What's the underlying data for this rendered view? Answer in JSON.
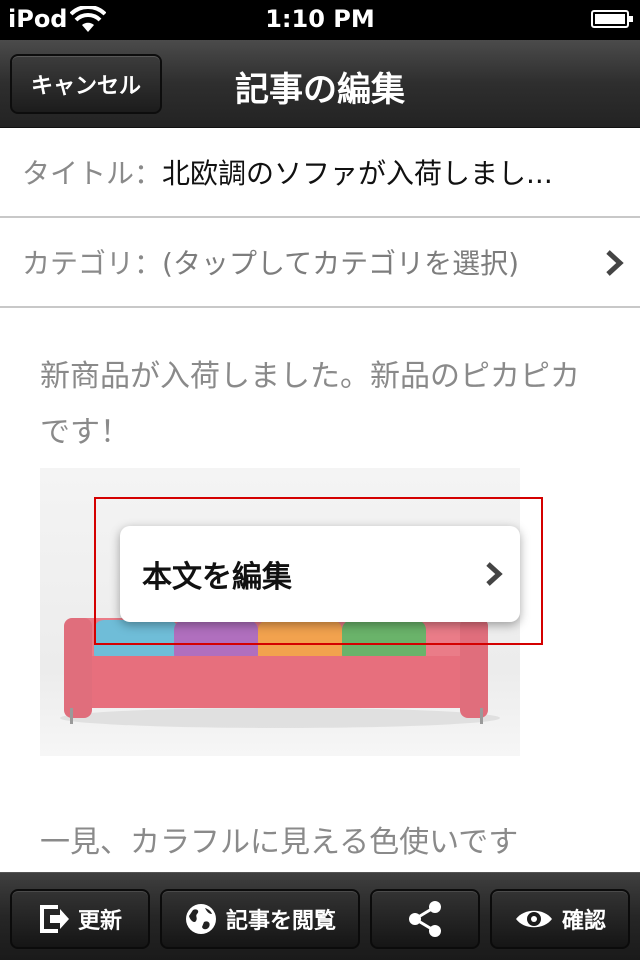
{
  "status_bar": {
    "carrier": "iPod",
    "time": "1:10 PM",
    "battery_level": 1.0
  },
  "nav_bar": {
    "cancel_label": "キャンセル",
    "title": "記事の編集"
  },
  "fields": {
    "title": {
      "label": "タイトル：",
      "value": "北欧調のソファが入荷しまし..."
    },
    "category": {
      "label": "カテゴリ：",
      "placeholder": "(タップしてカテゴリを選択)"
    }
  },
  "body": {
    "paragraph1": "新商品が入荷しました。新品のピカピカです！",
    "paragraph2": "一見、カラフルに見える色使いです"
  },
  "popup": {
    "label": "本文を編集"
  },
  "toolbar": {
    "update_label": "更新",
    "view_label": "記事を閲覧",
    "confirm_label": "確認"
  },
  "icons": {
    "wifi": "wifi-icon",
    "battery": "battery-icon",
    "chevron": "chevron-right-icon",
    "update": "exit-arrow-icon",
    "view": "globe-icon",
    "share": "share-icon",
    "confirm": "eye-icon"
  },
  "colors": {
    "highlight": "#d40000",
    "nav": "#2e2e2e",
    "toolbar": "#262626"
  }
}
